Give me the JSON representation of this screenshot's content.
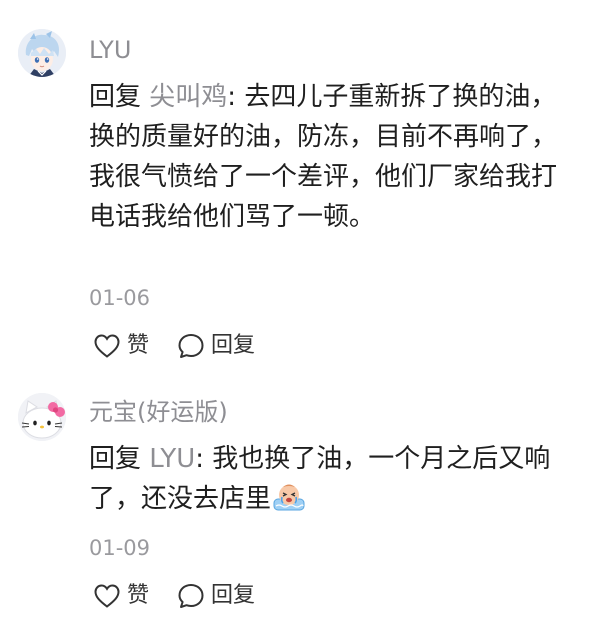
{
  "comments": [
    {
      "username": "LYU",
      "reply_prefix": "回复",
      "reply_target": "尖叫鸡",
      "colon": ":",
      "text": " 去四儿子重新拆了换的油，换的质量好的油，防冻，目前不再响了，我很气愤给了一个差评，他们厂家给我打电话我给他们骂了一顿。",
      "date": "01-06",
      "like_label": "赞",
      "reply_label": "回复",
      "avatar_icon": "anime-boy-avatar"
    },
    {
      "username": "元宝(好运版)",
      "reply_prefix": "回复",
      "reply_target": "LYU",
      "colon": ":",
      "text": " 我也换了油，一个月之后又响了，还没去店里",
      "date": "01-09",
      "like_label": "赞",
      "reply_label": "回复",
      "avatar_icon": "hello-kitty-avatar",
      "emoji_icon": "crying-face-emoji"
    }
  ],
  "colors": {
    "username": "#8e8e93",
    "text": "#1f1f1f",
    "date": "#9a9a9e"
  }
}
